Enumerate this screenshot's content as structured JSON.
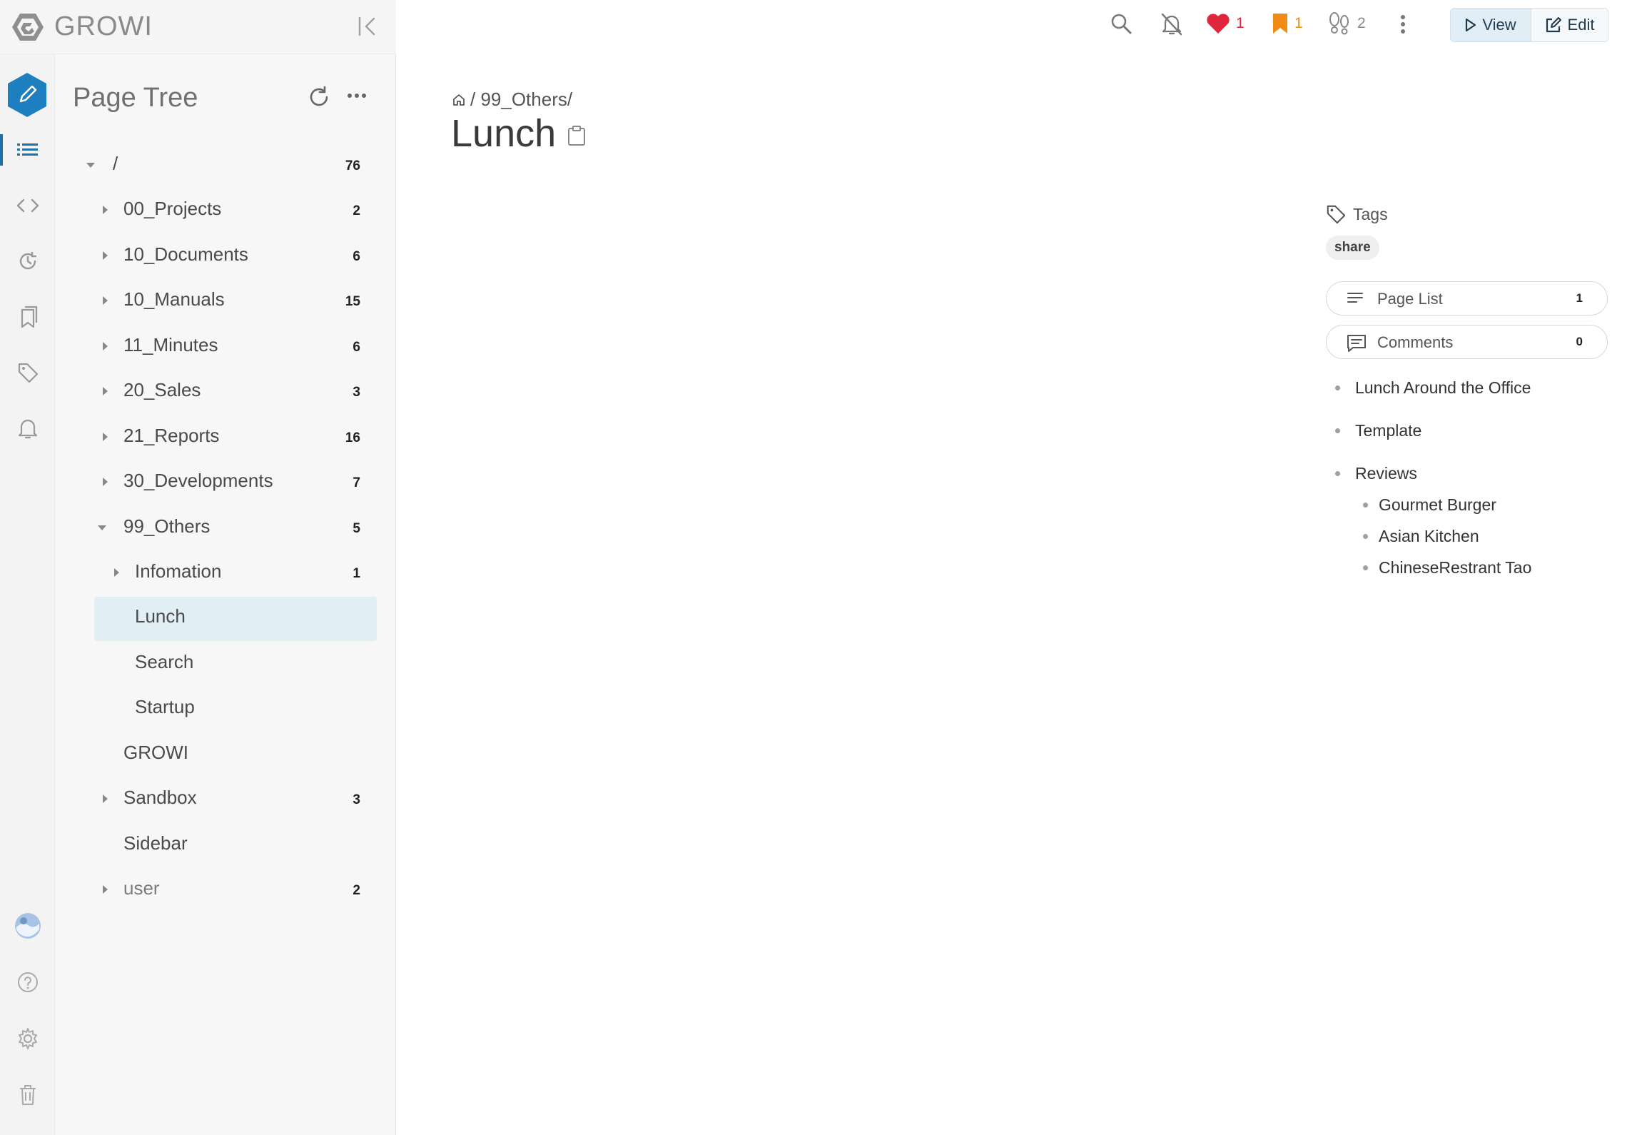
{
  "brand": {
    "name": "GROWI"
  },
  "rail": {
    "items": [
      {
        "icon": "list-icon"
      },
      {
        "icon": "code-icon"
      },
      {
        "icon": "history-icon"
      },
      {
        "icon": "bookmarks-icon"
      },
      {
        "icon": "tag-icon"
      },
      {
        "icon": "bell-icon"
      }
    ],
    "bottom": [
      {
        "icon": "avatar"
      },
      {
        "icon": "help-icon"
      },
      {
        "icon": "gear-icon"
      },
      {
        "icon": "trash-icon"
      }
    ]
  },
  "sidebar": {
    "title": "Page Tree",
    "tree": [
      {
        "label": "/",
        "count": "76",
        "expanded": true
      },
      {
        "label": "00_Projects",
        "count": "2"
      },
      {
        "label": "10_Documents",
        "count": "6"
      },
      {
        "label": "10_Manuals",
        "count": "15"
      },
      {
        "label": "11_Minutes",
        "count": "6"
      },
      {
        "label": "20_Sales",
        "count": "3"
      },
      {
        "label": "21_Reports",
        "count": "16"
      },
      {
        "label": "30_Developments",
        "count": "7"
      },
      {
        "label": "99_Others",
        "count": "5",
        "expanded": true
      },
      {
        "label": "Infomation",
        "count": "1"
      },
      {
        "label": "Lunch",
        "count": "",
        "selected": true
      },
      {
        "label": "Search",
        "count": ""
      },
      {
        "label": "Startup",
        "count": ""
      },
      {
        "label": "GROWI",
        "count": ""
      },
      {
        "label": "Sandbox",
        "count": "3"
      },
      {
        "label": "Sidebar",
        "count": ""
      },
      {
        "label": "user",
        "count": "2"
      }
    ]
  },
  "toolbar": {
    "likes": "1",
    "bookmarks": "1",
    "seen_users": "2",
    "view_label": "View",
    "edit_label": "Edit"
  },
  "page": {
    "breadcrumb": "/ 99_Others/",
    "title": "Lunch"
  },
  "right_panel": {
    "tags_label": "Tags",
    "tags": [
      "share"
    ],
    "page_list_label": "Page List",
    "page_list_count": "1",
    "comments_label": "Comments",
    "comments_count": "0",
    "toc": [
      "Lunch Around the Office",
      "Template",
      "Reviews",
      "Gourmet Burger",
      "Asian Kitchen",
      "ChineseRestrant Tao"
    ]
  },
  "colors": {
    "accent": "#1d6fa5",
    "like": "#e0263a",
    "bookmark": "#f08c16",
    "selected_row": "#e1eef4"
  }
}
